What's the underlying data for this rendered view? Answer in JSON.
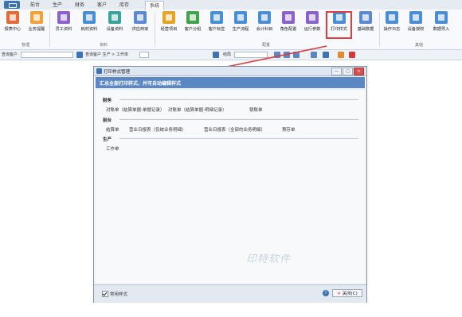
{
  "tabs": [
    "前台",
    "生产",
    "财务",
    "客户",
    "库存",
    "系统"
  ],
  "ribbon": {
    "items": [
      {
        "label": "报表中心",
        "color": "#e36b3a",
        "icon": "report-icon"
      },
      {
        "label": "业务提醒",
        "color": "#f0a23a",
        "icon": "reminder-icon"
      },
      {
        "label": "员工资料",
        "color": "#8b62c9",
        "icon": "employee-icon"
      },
      {
        "label": "耗材资料",
        "color": "#4a8fd6",
        "icon": "material-icon"
      },
      {
        "label": "设备资料",
        "color": "#3aa39b",
        "icon": "device-icon"
      },
      {
        "label": "供应商家",
        "color": "#5a8ad1",
        "icon": "supplier-icon"
      },
      {
        "label": "经营项目",
        "color": "#e7a326",
        "icon": "project-icon"
      },
      {
        "label": "客户分组",
        "color": "#3fa34d",
        "icon": "group-icon"
      },
      {
        "label": "客户标签",
        "color": "#4a8fd6",
        "icon": "tag-icon"
      },
      {
        "label": "生产流程",
        "color": "#4a8fd6",
        "icon": "process-icon"
      },
      {
        "label": "会计科目",
        "color": "#4a8fd6",
        "icon": "account-icon"
      },
      {
        "label": "角色配置",
        "color": "#8b62c9",
        "icon": "role-icon"
      },
      {
        "label": "运行参数",
        "color": "#8b62c9",
        "icon": "settings-icon"
      },
      {
        "label": "打印样式",
        "color": "#4a8fd6",
        "icon": "print-icon"
      },
      {
        "label": "基础数据",
        "color": "#5a8ad1",
        "icon": "data-icon"
      },
      {
        "label": "操作日志",
        "color": "#4a8fd6",
        "icon": "log-icon"
      },
      {
        "label": "设备授权",
        "color": "#4a8fd6",
        "icon": "auth-icon"
      },
      {
        "label": "数据导入",
        "color": "#4a8fd6",
        "icon": "import-icon"
      }
    ],
    "groups": [
      "管理",
      "资料",
      "配置",
      "其他"
    ]
  },
  "toolbar": {
    "query_customer": "查询客户",
    "query_path": "查询客户 生产 > 工作单",
    "date_label": "结局"
  },
  "dialog": {
    "title": "打印样式管理",
    "header": "汇总全部打印样式，并可自动编辑样式",
    "sections": [
      {
        "name": "财务",
        "items": [
          "对账单（结算单据-单据记录）",
          "对账单（结算单据-明细记录）",
          "销账单"
        ]
      },
      {
        "name": "前台",
        "items": [
          "结算单",
          "营业日报表（仅统业务明细）",
          "营业日报表（全部的业务明细）",
          "预存单"
        ]
      },
      {
        "name": "生产",
        "items": [
          "工作单"
        ]
      }
    ],
    "watermark": "印特软件",
    "checkbox_label": "常用样式",
    "help": "?",
    "close_label": "关闭(C)",
    "win_buttons": [
      "—",
      "□",
      "✕"
    ]
  }
}
